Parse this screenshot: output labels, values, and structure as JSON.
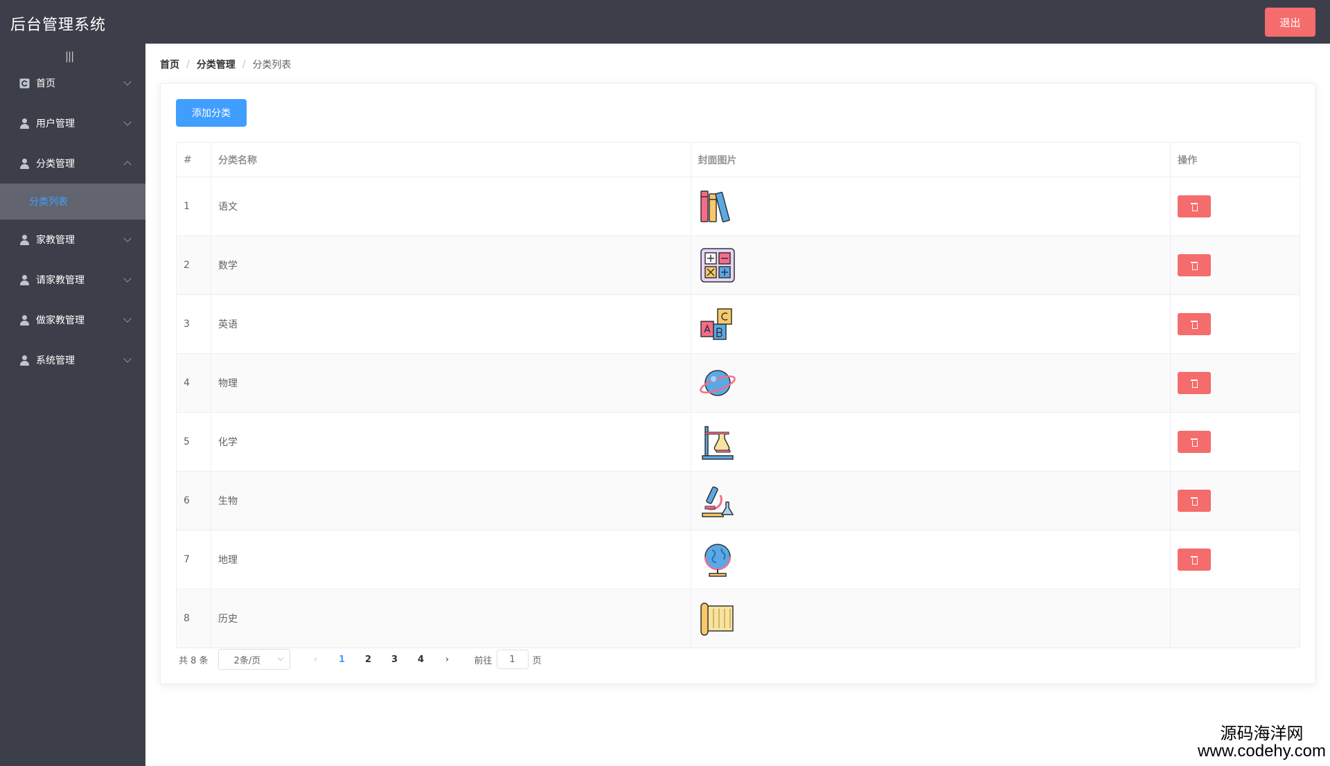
{
  "header": {
    "title": "后台管理系统",
    "logout_label": "退出"
  },
  "sidebar": {
    "toggle": "|||",
    "items": [
      {
        "label": "首页",
        "icon": "home-icon",
        "expanded": false
      },
      {
        "label": "用户管理",
        "icon": "user-icon",
        "expanded": false
      },
      {
        "label": "分类管理",
        "icon": "user-icon",
        "expanded": true
      },
      {
        "label": "家教管理",
        "icon": "user-icon",
        "expanded": false
      },
      {
        "label": "请家教管理",
        "icon": "user-icon",
        "expanded": false
      },
      {
        "label": "做家教管理",
        "icon": "user-icon",
        "expanded": false
      },
      {
        "label": "系统管理",
        "icon": "user-icon",
        "expanded": false
      }
    ],
    "active_sub": "分类列表"
  },
  "breadcrumb": {
    "home": "首页",
    "section": "分类管理",
    "current": "分类列表",
    "separator": "/"
  },
  "toolbar": {
    "add_label": "添加分类"
  },
  "table": {
    "headers": {
      "index": "#",
      "name": "分类名称",
      "image": "封面图片",
      "ops": "操作"
    },
    "rows": [
      {
        "index": "1",
        "name": "语文",
        "icon": "books-icon"
      },
      {
        "index": "2",
        "name": "数学",
        "icon": "math-icon"
      },
      {
        "index": "3",
        "name": "英语",
        "icon": "abc-blocks-icon"
      },
      {
        "index": "4",
        "name": "物理",
        "icon": "planet-icon"
      },
      {
        "index": "5",
        "name": "化学",
        "icon": "lab-stand-icon"
      },
      {
        "index": "6",
        "name": "生物",
        "icon": "microscope-icon"
      },
      {
        "index": "7",
        "name": "地理",
        "icon": "globe-icon"
      },
      {
        "index": "8",
        "name": "历史",
        "icon": "scroll-icon"
      }
    ],
    "delete_icon": "trash-icon"
  },
  "pagination": {
    "total": "共 8 条",
    "page_size": "2条/页",
    "pages": [
      "1",
      "2",
      "3",
      "4"
    ],
    "current": "1",
    "prev": "‹",
    "next": "›",
    "goto_label": "前往",
    "goto_value": "1",
    "page_suffix": "页"
  },
  "watermark": {
    "cn": "源码海洋网",
    "url": "www.codehy.com"
  },
  "colors": {
    "sidebar_bg": "#3c3f49",
    "primary": "#409eff",
    "danger": "#f56c6c",
    "submenu_bg": "#62656f"
  }
}
